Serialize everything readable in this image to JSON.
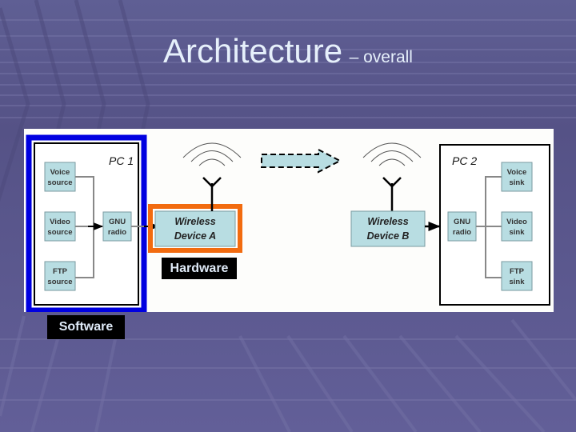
{
  "slide": {
    "title_main": "Architecture",
    "title_sub": "– overall"
  },
  "diagram": {
    "pc1": {
      "label": "PC 1",
      "blocks": [
        {
          "line1": "Voice",
          "line2": "source"
        },
        {
          "line1": "Video",
          "line2": "source"
        },
        {
          "line1": "FTP",
          "line2": "source"
        }
      ],
      "gnu": {
        "line1": "GNU",
        "line2": "radio"
      }
    },
    "device_a": {
      "line1": "Wireless",
      "line2": "Device A"
    },
    "device_b": {
      "line1": "Wireless",
      "line2": "Device B"
    },
    "pc2": {
      "label": "PC 2",
      "blocks": [
        {
          "line1": "Voice",
          "line2": "sink"
        },
        {
          "line1": "Video",
          "line2": "sink"
        },
        {
          "line1": "FTP",
          "line2": "sink"
        }
      ],
      "gnu": {
        "line1": "GNU",
        "line2": "radio"
      }
    },
    "annotations": {
      "software": "Software",
      "hardware": "Hardware"
    },
    "colors": {
      "block_fill": "#b8dde2",
      "software_highlight": "#0000e0",
      "hardware_highlight": "#f26b0f"
    }
  }
}
